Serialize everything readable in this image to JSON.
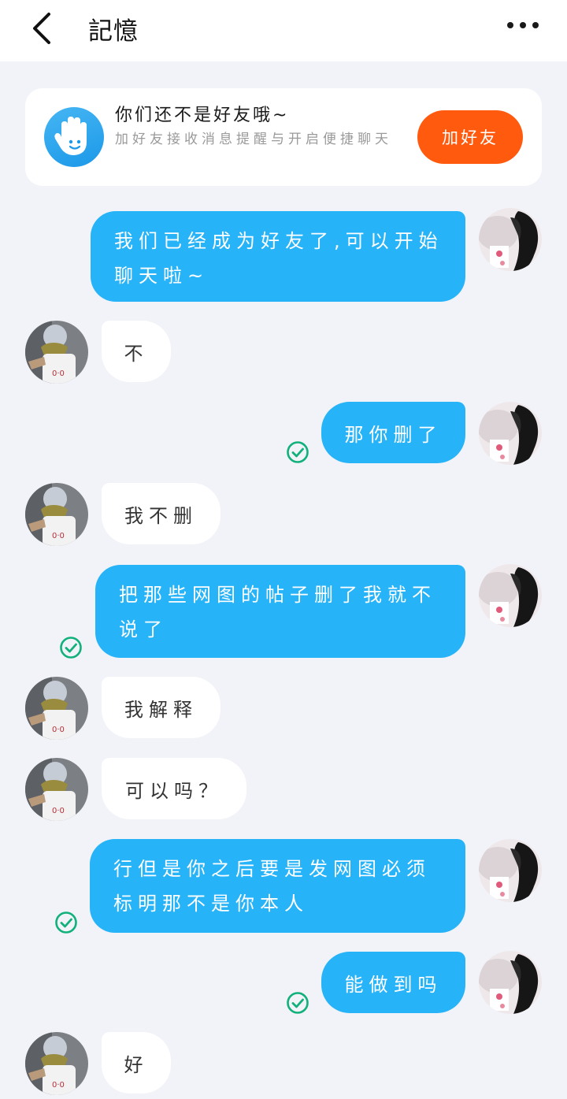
{
  "header": {
    "title": "記憶"
  },
  "banner": {
    "title": "你们还不是好友哦~",
    "description": "加好友接收消息提醒与开启便捷聊天",
    "add_button": "加好友"
  },
  "messages": [
    {
      "sender": "self",
      "text": "我们已经成为好友了,可以开始聊天啦~",
      "read": false
    },
    {
      "sender": "other",
      "text": "不"
    },
    {
      "sender": "self",
      "text": "那你删了",
      "read": true
    },
    {
      "sender": "other",
      "text": "我不删"
    },
    {
      "sender": "self",
      "text": "把那些网图的帖子删了我就不说了",
      "read": true
    },
    {
      "sender": "other",
      "text": "我解释"
    },
    {
      "sender": "other",
      "text": "可以吗？"
    },
    {
      "sender": "self",
      "text": "行但是你之后要是发网图必须标明那不是你本人",
      "read": true
    },
    {
      "sender": "self",
      "text": "能做到吗",
      "read": true
    },
    {
      "sender": "other",
      "text": "好"
    }
  ],
  "colors": {
    "self_bubble": "#27b3f8",
    "other_bubble": "#ffffff",
    "add_button": "#ff5a0d",
    "read_check": "#12b07a",
    "background": "#f2f3f8"
  },
  "icons": {
    "back": "chevron-left-icon",
    "more": "more-dots-icon",
    "banner": "hand-wave-icon",
    "read": "check-circle-icon"
  }
}
